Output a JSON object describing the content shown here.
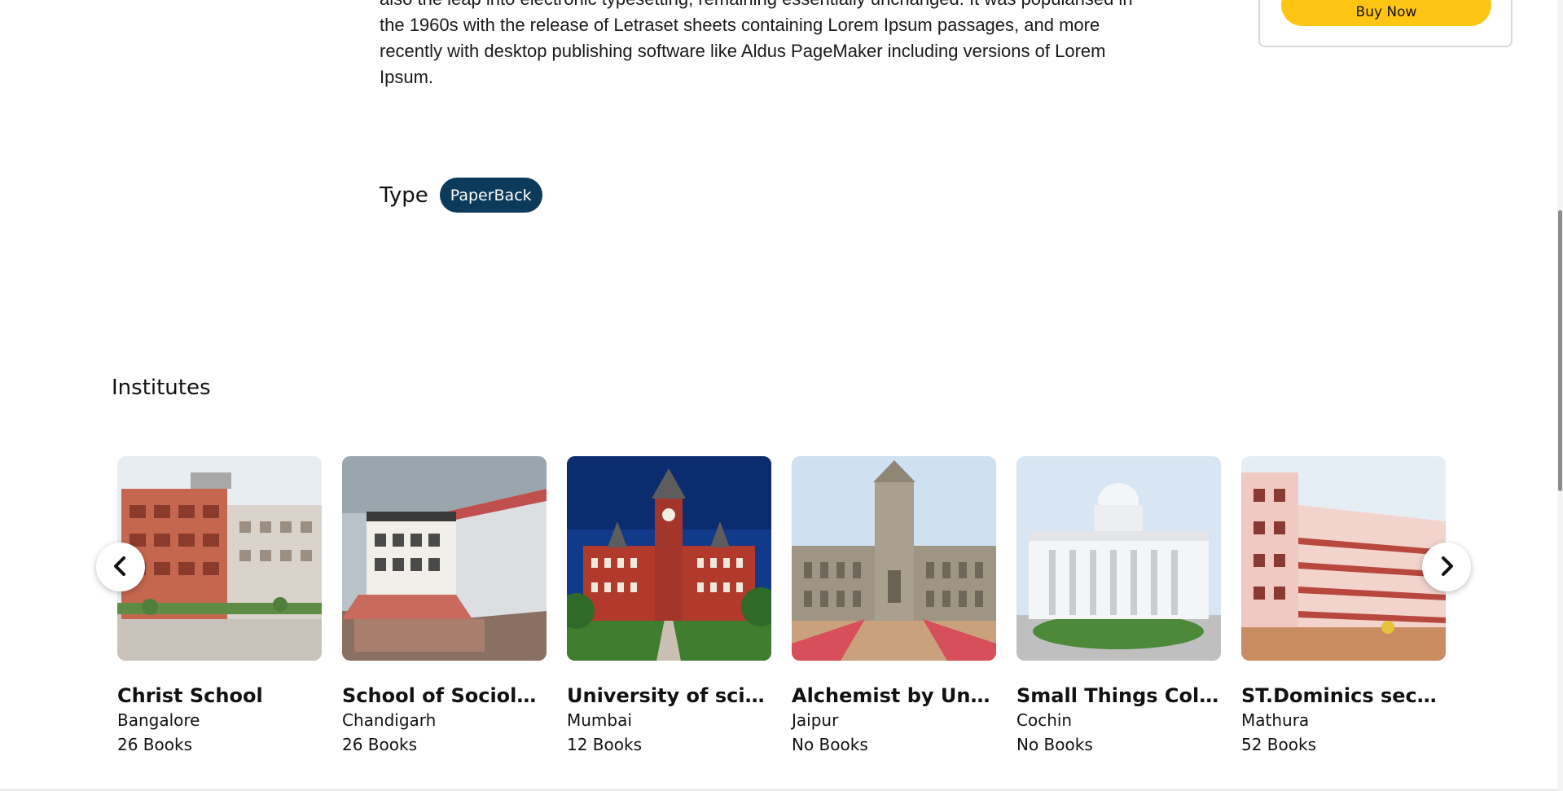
{
  "description": {
    "lines": [
      "also the leap into electronic typesetting, remaining essentially unchanged. It was popularised in",
      "the 1960s with the release of Letraset sheets containing Lorem Ipsum passages, and more",
      "recently with desktop publishing software like Aldus PageMaker including versions of Lorem",
      "Ipsum."
    ]
  },
  "purchase": {
    "buy_label": "Buy Now"
  },
  "type": {
    "label": "Type",
    "value": "PaperBack"
  },
  "institutes": {
    "title": "Institutes",
    "items": [
      {
        "name": "Christ School",
        "city": "Bangalore",
        "books": "26 Books",
        "image": "building-brick"
      },
      {
        "name": "School of Sociology",
        "city": "Chandigarh",
        "books": "26 Books",
        "image": "building-white"
      },
      {
        "name": "University of scien...",
        "city": "Mumbai",
        "books": "12 Books",
        "image": "building-clocktower"
      },
      {
        "name": "Alchemist by Univ...",
        "city": "Jaipur",
        "books": "No Books",
        "image": "building-stone-tower"
      },
      {
        "name": "Small Things Colle...",
        "city": "Cochin",
        "books": "No Books",
        "image": "building-dome"
      },
      {
        "name": "ST.Dominics secon...",
        "city": "Mathura",
        "books": "52 Books",
        "image": "building-pink"
      }
    ]
  },
  "colors": {
    "accent_yellow": "#ffc515",
    "chip_navy": "#0c3a5b"
  },
  "icons": {
    "prev": "chevron-left-icon",
    "next": "chevron-right-icon"
  }
}
